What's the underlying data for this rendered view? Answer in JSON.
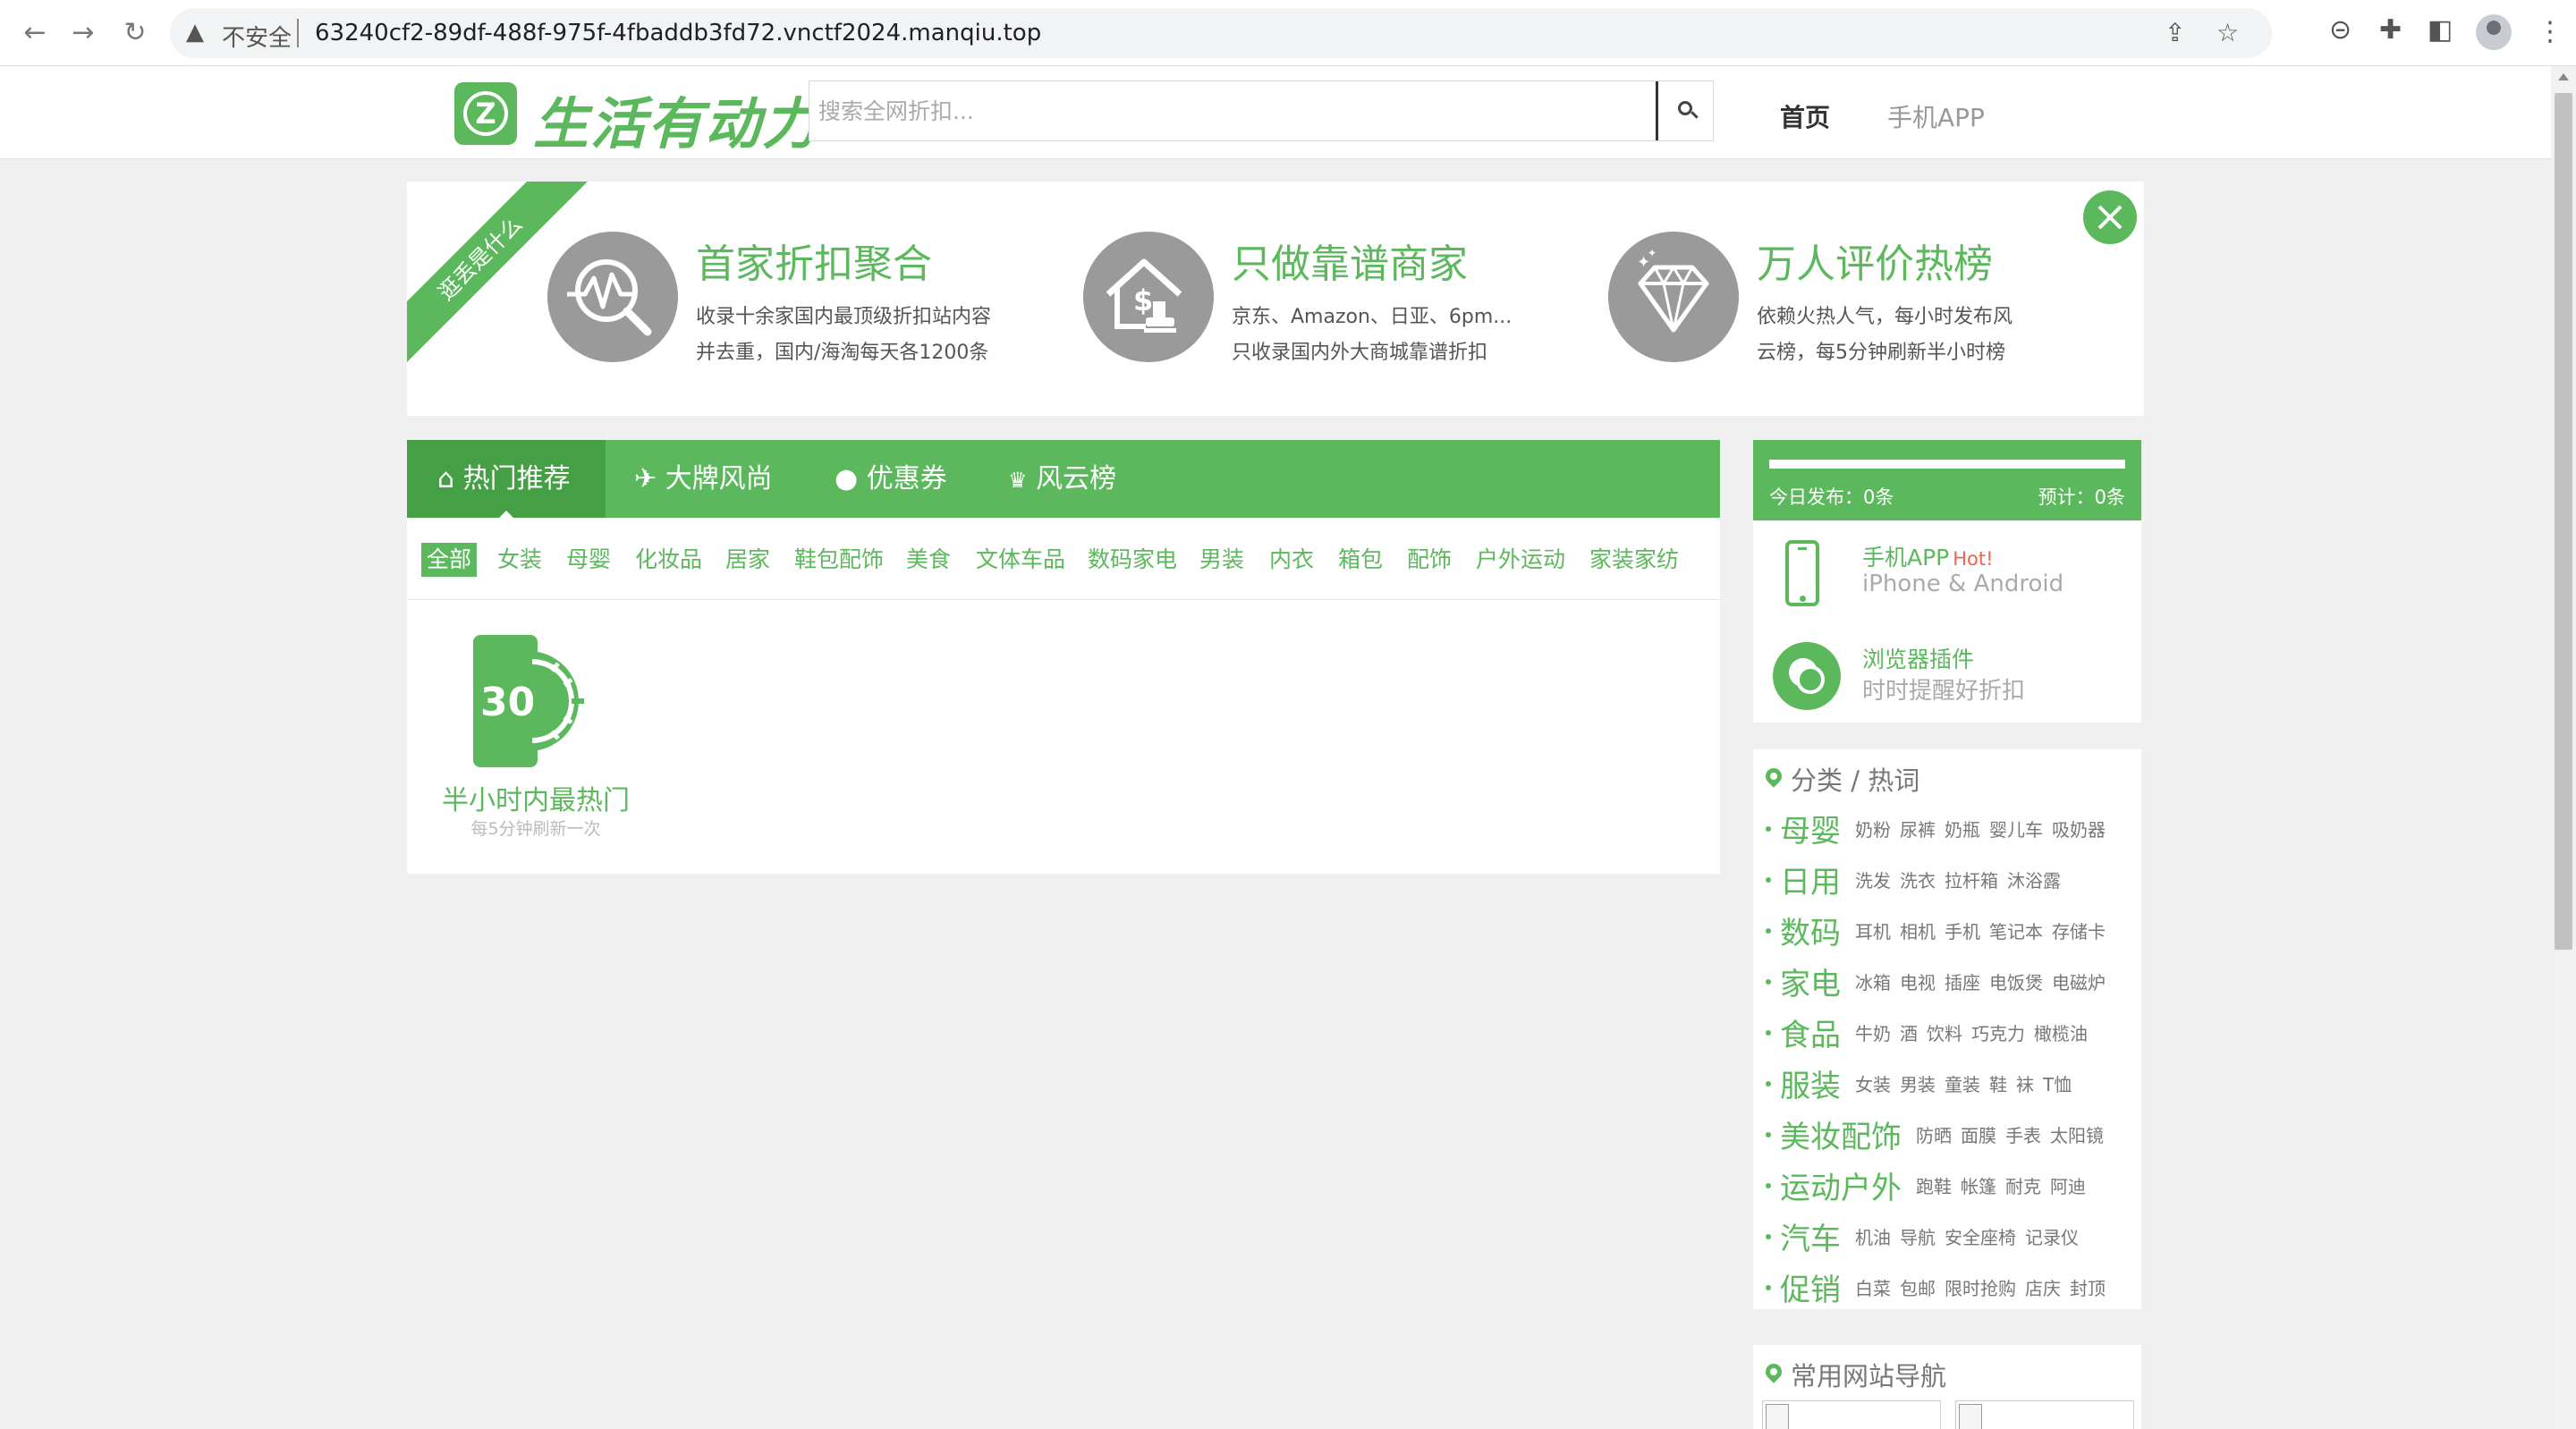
{
  "browser": {
    "insecure_label": "不安全",
    "url": "63240cf2-89df-488f-975f-4fbaddb3fd72.vnctf2024.manqiu.top"
  },
  "header": {
    "logo_badge": "Z",
    "logo_text": "生活有动力",
    "search_placeholder": "搜索全网折扣...",
    "nav_home": "首页",
    "nav_app": "手机APP"
  },
  "banner": {
    "ribbon": "逛丢是什么",
    "features": [
      {
        "title": "首家折扣聚合",
        "line1": "收录十余家国内最顶级折扣站内容",
        "line2": "并去重，国内/海淘每天各1200条",
        "icon": "magnifier-chart-icon"
      },
      {
        "title": "只做靠谱商家",
        "line1": "京东、Amazon、日亚、6pm...",
        "line2": "只收录国内外大商城靠谱折扣",
        "icon": "house-dollar-stamp-icon"
      },
      {
        "title": "万人评价热榜",
        "line1": "依赖火热人气，每小时发布风",
        "line2": "云榜，每5分钟刷新半小时榜",
        "icon": "diamond-icon"
      }
    ]
  },
  "tabs": [
    {
      "icon": "⌂",
      "label": "热门推荐"
    },
    {
      "icon": "✈",
      "label": "大牌风尚"
    },
    {
      "icon": "●",
      "label": "优惠券"
    },
    {
      "icon": "♛",
      "label": "风云榜"
    }
  ],
  "categories": [
    "全部",
    "女装",
    "母婴",
    "化妆品",
    "居家",
    "鞋包配饰",
    "美食",
    "文体车品",
    "数码家电",
    "男装",
    "内衣",
    "箱包",
    "配饰",
    "户外运动",
    "家装家纺"
  ],
  "hot_card": {
    "number": "30",
    "title": "半小时内最热门",
    "subtitle": "每5分钟刷新一次"
  },
  "stats": {
    "today": "今日发布：0条",
    "forecast": "预计：0条",
    "progress": 1.0
  },
  "apps": [
    {
      "title": "手机APP",
      "hot": "Hot!",
      "sub": "iPhone & Android"
    },
    {
      "title": "浏览器插件",
      "hot": "",
      "sub": "时时提醒好折扣"
    }
  ],
  "cat_box": {
    "heading": "分类 / 热词",
    "rows": [
      {
        "name": "母婴",
        "words": [
          "奶粉",
          "尿裤",
          "奶瓶",
          "婴儿车",
          "吸奶器"
        ]
      },
      {
        "name": "日用",
        "words": [
          "洗发",
          "洗衣",
          "拉杆箱",
          "沐浴露"
        ]
      },
      {
        "name": "数码",
        "words": [
          "耳机",
          "相机",
          "手机",
          "笔记本",
          "存储卡"
        ]
      },
      {
        "name": "家电",
        "words": [
          "冰箱",
          "电视",
          "插座",
          "电饭煲",
          "电磁炉"
        ]
      },
      {
        "name": "食品",
        "words": [
          "牛奶",
          "酒",
          "饮料",
          "巧克力",
          "橄榄油"
        ]
      },
      {
        "name": "服装",
        "words": [
          "女装",
          "男装",
          "童装",
          "鞋",
          "袜",
          "T恤"
        ]
      },
      {
        "name": "美妆配饰",
        "words": [
          "防晒",
          "面膜",
          "手表",
          "太阳镜"
        ]
      },
      {
        "name": "运动户外",
        "words": [
          "跑鞋",
          "帐篷",
          "耐克",
          "阿迪"
        ]
      },
      {
        "name": "汽车",
        "words": [
          "机油",
          "导航",
          "安全座椅",
          "记录仪"
        ]
      },
      {
        "name": "促销",
        "words": [
          "白菜",
          "包邮",
          "限时抢购",
          "店庆",
          "封顶"
        ]
      }
    ]
  },
  "sites_box": {
    "heading": "常用网站导航"
  }
}
